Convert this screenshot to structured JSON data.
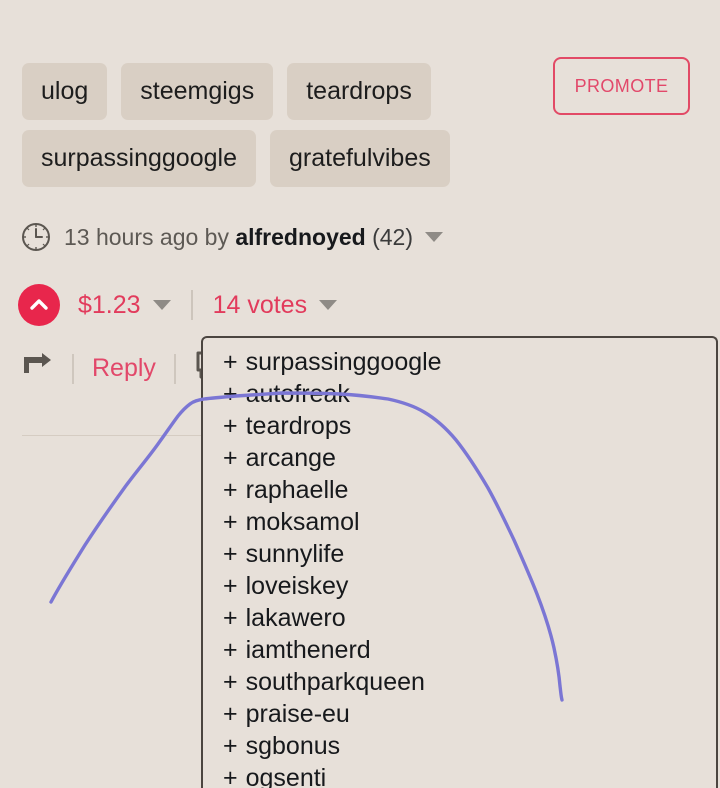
{
  "page": {
    "background_color": "#e7e0d9",
    "chip_color": "#d9cfc4",
    "accent_color": "#e2486a",
    "vote_button_color": "#e8264c",
    "curve_color": "#7b76d4"
  },
  "tags": {
    "row1": [
      "ulog",
      "steemgigs",
      "teardrops"
    ],
    "row2": [
      "surpassinggoogle",
      "gratefulvibes"
    ]
  },
  "promote": {
    "label": "PROMOTE"
  },
  "meta": {
    "icon": "clock-icon",
    "time": "13 hours ago by ",
    "author": "alfrednoyed",
    "reputation": " (42)"
  },
  "payout": {
    "vote_icon": "chevron-up-icon",
    "amount": "$1.23",
    "votes": "14 votes"
  },
  "actions": {
    "resteem_icon": "resteem-arrow-icon",
    "reply_label": "Reply",
    "comment_icon": "comment-bubble-icon"
  },
  "voters": {
    "items": [
      "surpassinggoogle",
      "autofreak",
      "teardrops",
      "arcange",
      "raphaelle",
      "moksamol",
      "sunnylife",
      "loveiskey",
      "lakawero",
      "iamthenerd",
      "southparkqueen",
      "praise-eu",
      "sgbonus",
      "ogsenti"
    ],
    "prefix": "+"
  }
}
